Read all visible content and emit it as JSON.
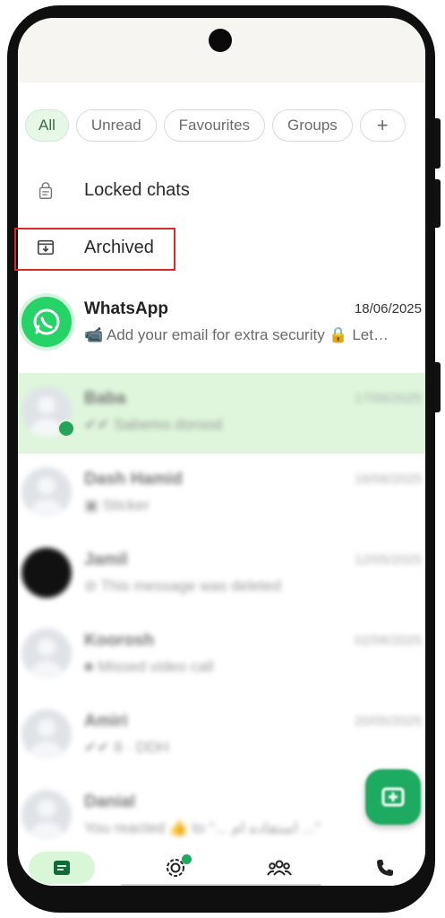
{
  "filters": {
    "all": "All",
    "unread": "Unread",
    "favourites": "Favourites",
    "groups": "Groups",
    "add": "+"
  },
  "utility": {
    "locked_chats": "Locked chats",
    "archived": "Archived"
  },
  "chats": [
    {
      "name": "WhatsApp",
      "time": "18/06/2025",
      "preview": "📹 Add your email for extra security 🔒 Let…"
    },
    {
      "name": "Baba",
      "time": "17/06/2025",
      "preview": "✔✔ Sabemo dorood"
    },
    {
      "name": "Dash Hamid",
      "time": "16/06/2025",
      "preview": "▣ Sticker"
    },
    {
      "name": "Jamil",
      "time": "12/05/2025",
      "preview": "⊘ This message was deleted"
    },
    {
      "name": "Koorosh",
      "time": "02/06/2025",
      "preview": "■ Missed video call"
    },
    {
      "name": "Amiri",
      "time": "20/05/2025",
      "preview": "✔✔ 8 · DDH"
    },
    {
      "name": "Danial",
      "time": "",
      "preview": "You reacted 👍 to \"... استفاده ام ...\""
    }
  ],
  "colors": {
    "accent": "#25d366",
    "selected_row": "#dff6dc",
    "highlight_box": "#d92b2b"
  },
  "nav": {
    "chats_icon": "chats-icon",
    "updates_icon": "updates-icon",
    "communities_icon": "communities-icon",
    "calls_icon": "calls-icon"
  }
}
